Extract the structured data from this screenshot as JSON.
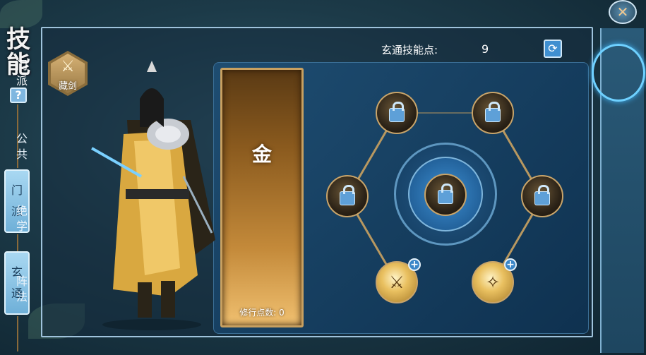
{
  "screen": {
    "title_chars": [
      "技",
      "能"
    ],
    "help_label": "?"
  },
  "left_tabs": [
    {
      "chars": [
        "门",
        "派"
      ]
    },
    {
      "chars": [
        "玄",
        "通"
      ]
    }
  ],
  "sect": {
    "name": "藏剑"
  },
  "skill_points": {
    "label": "玄通技能点:",
    "value": "9"
  },
  "element_card": {
    "element": "金",
    "cultivation_label": "修行点数: 0"
  },
  "right_tabs": [
    {
      "chars": [
        "门",
        "派"
      ],
      "active": true
    },
    {
      "chars": [
        "公",
        "共"
      ],
      "active": false
    },
    {
      "chars": [
        "绝",
        "学"
      ],
      "active": false
    },
    {
      "chars": [
        "阵",
        "法"
      ],
      "active": false
    }
  ],
  "skill_nodes": [
    {
      "id": "top-left",
      "state": "locked",
      "icon": "lock-icon"
    },
    {
      "id": "top-right",
      "state": "locked",
      "icon": "lock-icon"
    },
    {
      "id": "mid-left",
      "state": "locked",
      "icon": "lock-icon"
    },
    {
      "id": "center",
      "state": "locked",
      "icon": "lock-icon"
    },
    {
      "id": "mid-right",
      "state": "locked",
      "icon": "lock-icon"
    },
    {
      "id": "bottom-left",
      "state": "upgradable",
      "icon": "sword-skill-icon"
    },
    {
      "id": "bottom-right",
      "state": "upgradable",
      "icon": "slash-skill-icon"
    }
  ],
  "icons": {
    "refresh": "refresh-icon",
    "close": "close-icon",
    "sect_emblem": "sword-emblem-icon"
  }
}
